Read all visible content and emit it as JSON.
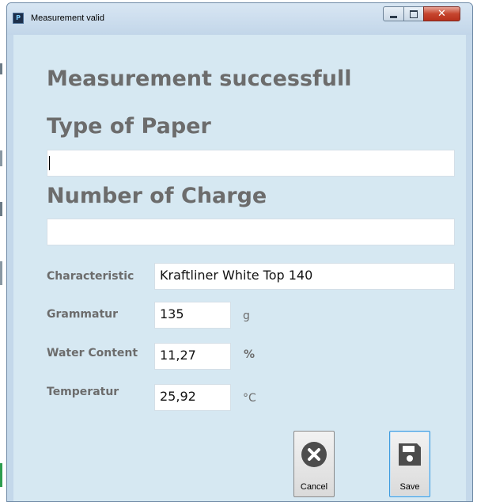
{
  "window": {
    "title": "Measurement valid",
    "icon": "app-icon",
    "controls": {
      "minimize": "minimize-icon",
      "maximize": "maximize-icon",
      "close": "✕"
    }
  },
  "form": {
    "status_heading": "Measurement successfull",
    "type_of_paper": {
      "label": "Type of Paper",
      "value": ""
    },
    "number_of_charge": {
      "label": "Number of Charge",
      "value": ""
    },
    "characteristic": {
      "label": "Characteristic",
      "value": "Kraftliner White Top 140"
    },
    "grammatur": {
      "label": "Grammatur",
      "value": "135",
      "unit": "g"
    },
    "water_content": {
      "label": "Water Content",
      "value": "11,27",
      "unit": "%"
    },
    "temperatur": {
      "label": "Temperatur",
      "value": "25,92",
      "unit": "°C"
    }
  },
  "buttons": {
    "cancel": {
      "label": "Cancel",
      "icon": "cancel-x-circle-icon"
    },
    "save": {
      "label": "Save",
      "icon": "floppy-disk-icon"
    }
  },
  "colors": {
    "window_frame": "#c4d8ea",
    "client_background": "#d6e8f2",
    "label_text": "#6c6c6c",
    "icon_dark": "#4d4d4d",
    "close_button": "#c6452e",
    "save_highlight": "#3d9be0"
  }
}
